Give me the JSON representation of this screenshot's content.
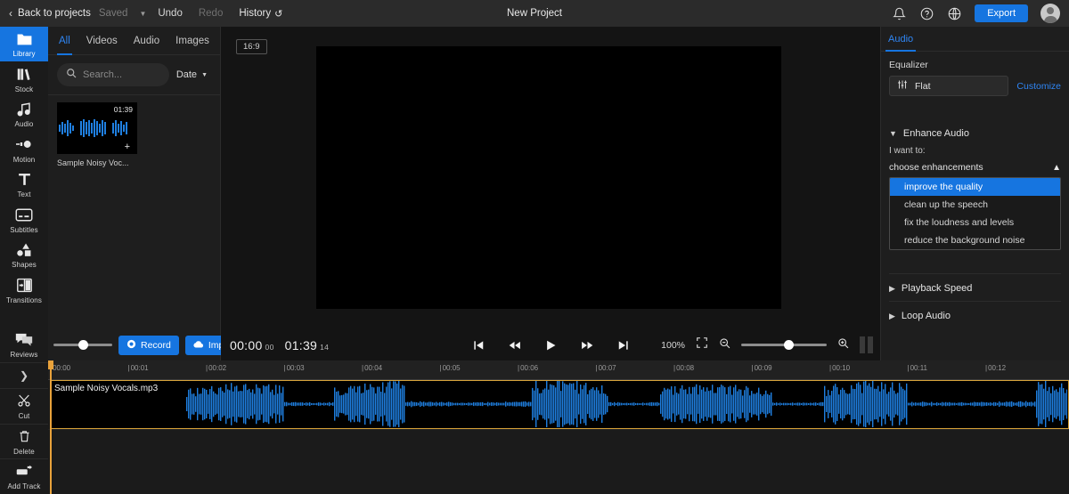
{
  "topbar": {
    "back_label": "Back to projects",
    "saved_label": "Saved",
    "undo_label": "Undo",
    "redo_label": "Redo",
    "history_label": "History",
    "project_title": "New Project",
    "export_label": "Export",
    "icons": {
      "back_chevron": "chevron-left-icon",
      "dropdown_caret": "caret-down-icon",
      "history": "history-undo-icon",
      "bell": "notification-bell-icon",
      "help": "help-circle-icon",
      "globe": "language-globe-icon",
      "avatar": "user-avatar-icon"
    }
  },
  "rail": {
    "items": [
      {
        "label": "Library",
        "icon": "folder-icon",
        "active": true
      },
      {
        "label": "Stock",
        "icon": "stock-books-icon",
        "active": false
      },
      {
        "label": "Audio",
        "icon": "music-note-icon",
        "active": false
      },
      {
        "label": "Motion",
        "icon": "motion-icon",
        "active": false
      },
      {
        "label": "Text",
        "icon": "text-t-icon",
        "active": false
      },
      {
        "label": "Subtitles",
        "icon": "subtitles-icon",
        "active": false
      },
      {
        "label": "Shapes",
        "icon": "shapes-icon",
        "active": false
      },
      {
        "label": "Transitions",
        "icon": "transitions-icon",
        "active": false
      },
      {
        "label": "Reviews",
        "icon": "comments-icon",
        "active": false
      }
    ],
    "collapse_icon": "chevron-right-icon",
    "tools": [
      {
        "label": "Cut",
        "icon": "scissors-icon"
      },
      {
        "label": "Delete",
        "icon": "trash-icon"
      },
      {
        "label": "Add Track",
        "icon": "add-track-icon"
      }
    ]
  },
  "library": {
    "tabs": [
      {
        "label": "All",
        "active": true
      },
      {
        "label": "Videos",
        "active": false
      },
      {
        "label": "Audio",
        "active": false
      },
      {
        "label": "Images",
        "active": false
      }
    ],
    "search": {
      "placeholder": "Search...",
      "value": "",
      "icon": "search-icon"
    },
    "sort": {
      "label": "Date",
      "caret": "caret-down-icon"
    },
    "media": [
      {
        "name": "Sample Noisy Voc...",
        "duration": "01:39",
        "add_icon": "plus-icon"
      }
    ],
    "footer": {
      "record_label": "Record",
      "record_icon": "record-dot-icon",
      "import_label": "Import",
      "import_icon": "cloud-upload-icon",
      "volume_value": 45
    }
  },
  "preview": {
    "ratio_label": "16:9"
  },
  "player": {
    "current_time": "00:00",
    "current_frames": "00",
    "total_time": "01:39",
    "total_frames": "14",
    "zoom_level": "100%",
    "zoom_slider_value": 50,
    "controls": [
      {
        "name": "skip-to-start-button",
        "icon": "skip-start-icon"
      },
      {
        "name": "rewind-button",
        "icon": "rewind-icon"
      },
      {
        "name": "play-button",
        "icon": "play-icon"
      },
      {
        "name": "fast-forward-button",
        "icon": "fast-forward-icon"
      },
      {
        "name": "skip-to-end-button",
        "icon": "skip-end-icon"
      }
    ],
    "fullscreen_icon": "fullscreen-icon",
    "zoom_out_icon": "zoom-out-icon",
    "zoom_in_icon": "zoom-in-icon",
    "pause_icon": "pause-icon"
  },
  "right_panel": {
    "tabs": [
      {
        "label": "Audio",
        "active": true
      }
    ],
    "equalizer": {
      "section_label": "Equalizer",
      "preset_value": "Flat",
      "preset_icon": "equalizer-sliders-icon",
      "customize_label": "Customize"
    },
    "enhance_audio": {
      "title": "Enhance Audio",
      "expanded": true,
      "chevron": "chevron-down-icon",
      "prompt_label": "I want to:",
      "select_value": "choose enhancements",
      "select_caret": "chevron-up-icon",
      "options": [
        {
          "label": "improve the quality",
          "selected": true
        },
        {
          "label": "clean up the speech",
          "selected": false
        },
        {
          "label": "fix the loudness and levels",
          "selected": false
        },
        {
          "label": "reduce the background noise",
          "selected": false
        }
      ]
    },
    "sections": [
      {
        "title": "Playback Speed",
        "expanded": false,
        "chevron": "chevron-right-icon"
      },
      {
        "title": "Loop Audio",
        "expanded": false,
        "chevron": "chevron-right-icon"
      }
    ]
  },
  "timeline": {
    "ruler_ticks": [
      "00:00",
      "00:01",
      "00:02",
      "00:03",
      "00:04",
      "00:05",
      "00:06",
      "00:07",
      "00:08",
      "00:09",
      "00:10",
      "00:11",
      "00:12"
    ],
    "clip": {
      "name": "Sample Noisy Vocals.mp3",
      "selected": true
    },
    "playhead_position": "00:00"
  },
  "colors": {
    "accent": "#1675e0",
    "accent_text": "#2f86f5",
    "waveform": "#1f7fe0",
    "selection_border": "#d8a33a",
    "playhead": "#e9a23b",
    "panel_bg": "#1e1e1e",
    "rail_bg": "#1b1b1b",
    "topbar_bg": "#2b2b2b"
  }
}
